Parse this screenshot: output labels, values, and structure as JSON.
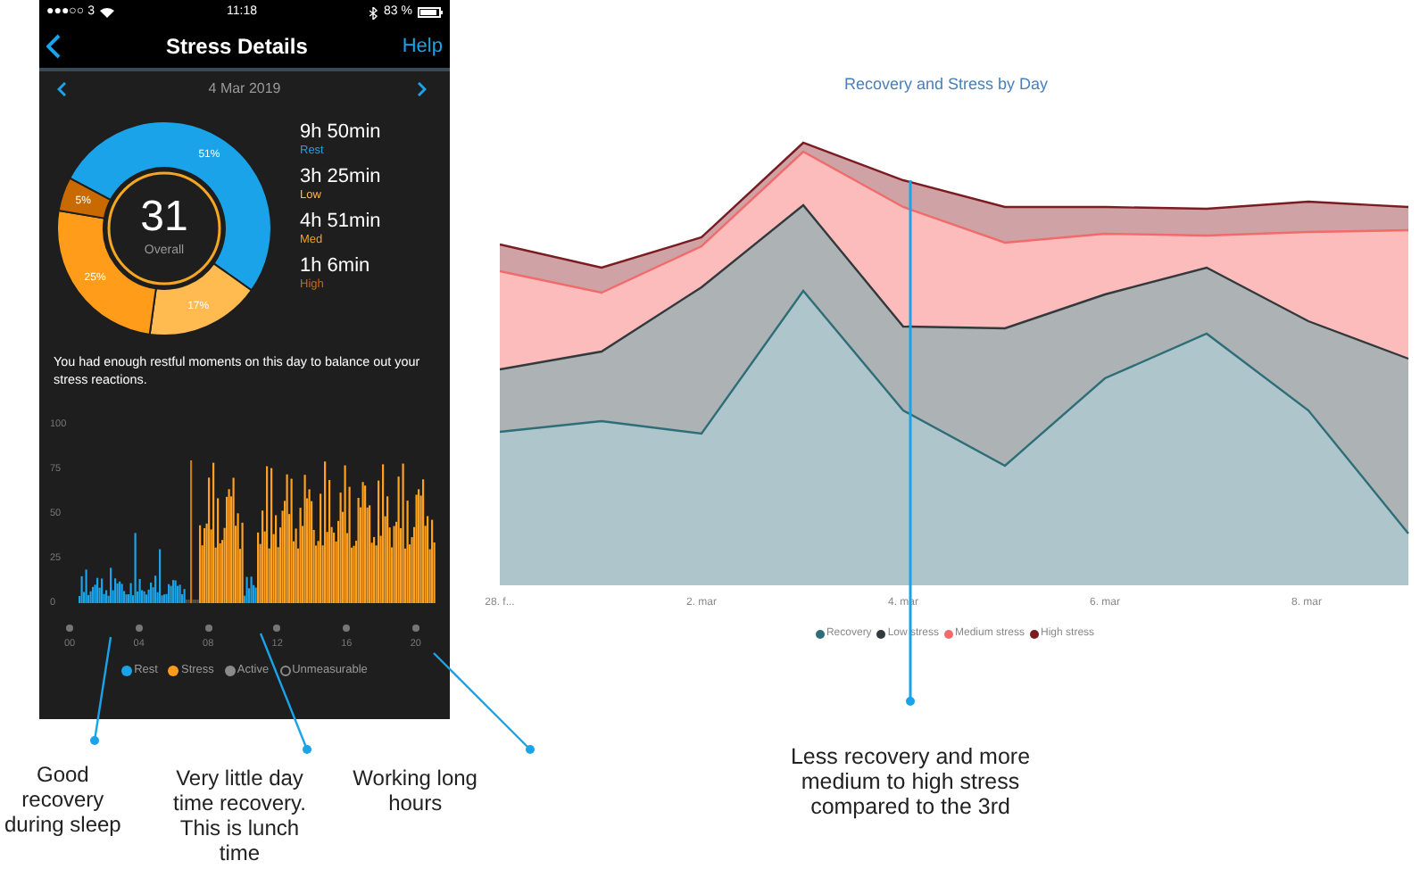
{
  "phone": {
    "status_bar": {
      "carrier": "●●●○○ 3",
      "time": "11:18",
      "battery": "83 %"
    },
    "header": {
      "title": "Stress Details",
      "action": "Help"
    },
    "date": "4 Mar 2019",
    "donut": {
      "score": "31",
      "score_label": "Overall",
      "chart_data": {
        "type": "donut",
        "values": [
          51,
          17,
          25,
          5
        ],
        "value_labels": [
          "51%",
          "17%",
          "25%",
          "5%"
        ]
      }
    },
    "stats": [
      {
        "duration": "9h 50min",
        "label": "Rest",
        "color": "#1aa3e8"
      },
      {
        "duration": "3h 25min",
        "label": "Low",
        "color": "#ffbb4f"
      },
      {
        "duration": "4h 51min",
        "label": "Med",
        "color": "#ff9d1a"
      },
      {
        "duration": "1h 6min",
        "label": "High",
        "color": "#c96a00"
      }
    ],
    "message": "You had enough restful moments on this day to balance out your stress reactions.",
    "stress_chart": {
      "yticks": [
        "100",
        "75",
        "50",
        "25",
        "0"
      ],
      "xticks": [
        "00",
        "04",
        "08",
        "12",
        "16",
        "20"
      ]
    },
    "legend": [
      {
        "label": "Rest",
        "kind": "filled",
        "color": "#1aa3e8"
      },
      {
        "label": "Stress",
        "kind": "filled",
        "color": "#ff9d1a"
      },
      {
        "label": "Active",
        "kind": "filled",
        "color": "#8a8a8a"
      },
      {
        "label": "Unmeasurable",
        "kind": "outline",
        "color": "#8a8a8a"
      }
    ]
  },
  "annotations": [
    {
      "text": "Good recovery during sleep"
    },
    {
      "text": "Very little day time recovery. This is lunch time"
    },
    {
      "text": "Working long hours"
    }
  ],
  "daily_chart": {
    "title": "Recovery and Stress by Day",
    "xlabels": [
      "28. f...",
      "2. mar",
      "4. mar",
      "6. mar",
      "8. mar"
    ],
    "legend": [
      {
        "label": "Recovery",
        "color": "#2e6e78"
      },
      {
        "label": "Low stress",
        "color": "#333a3d"
      },
      {
        "label": "Medium stress",
        "color": "#f26b6b"
      },
      {
        "label": "High stress",
        "color": "#7a1c22"
      }
    ],
    "annotation": "Less recovery and more medium to high stress compared to the 3rd"
  }
}
